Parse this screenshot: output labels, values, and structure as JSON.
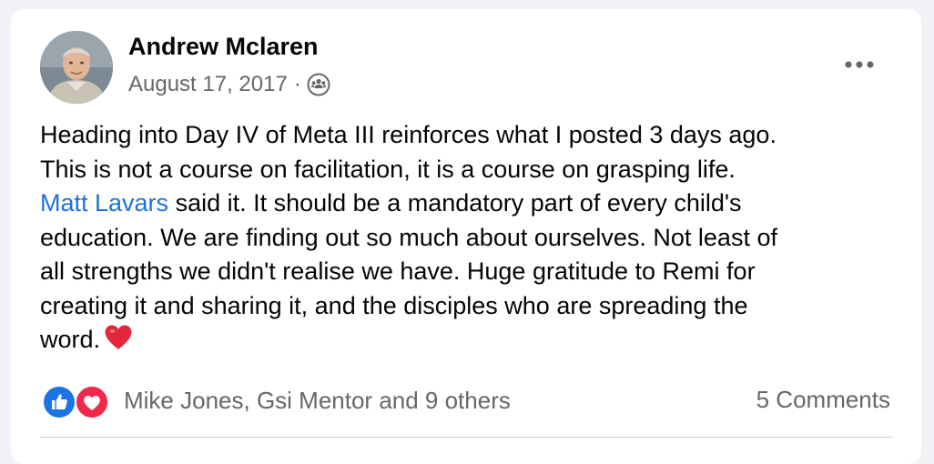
{
  "post": {
    "author": {
      "name": "Andrew Mclaren",
      "avatar_icon": "profile-photo-avatar"
    },
    "date": "August 17, 2017",
    "meta_separator": "·",
    "audience_icon": "friends-icon",
    "more_icon": "more-options-icon",
    "body": {
      "line1": "Heading into Day IV of Meta III reinforces what I posted 3 days ago.",
      "line2": "This is not a course on facilitation, it is a course on grasping life.",
      "line3_mention": "Matt Lavars",
      "line3_rest": " said it. It should be a mandatory part of every child's",
      "line4": "education. We are finding out so much about ourselves. Not least of",
      "line5": "all strengths we didn't realise we have. Huge gratitude to Remi for",
      "line6": "creating it and sharing it, and the disciples who are spreading the",
      "line7": "word.",
      "emoji": "heart-emoji"
    },
    "reactions": {
      "icons": [
        "like-icon",
        "love-icon"
      ],
      "summary": "Mike Jones, Gsi Mentor and 9 others"
    },
    "comments_count": "5 Comments"
  },
  "colors": {
    "mention": "#216fdb",
    "like": "#1b74e4",
    "love": "#f0284a",
    "secondary_text": "#65676b",
    "background": "#f0f2f5"
  }
}
